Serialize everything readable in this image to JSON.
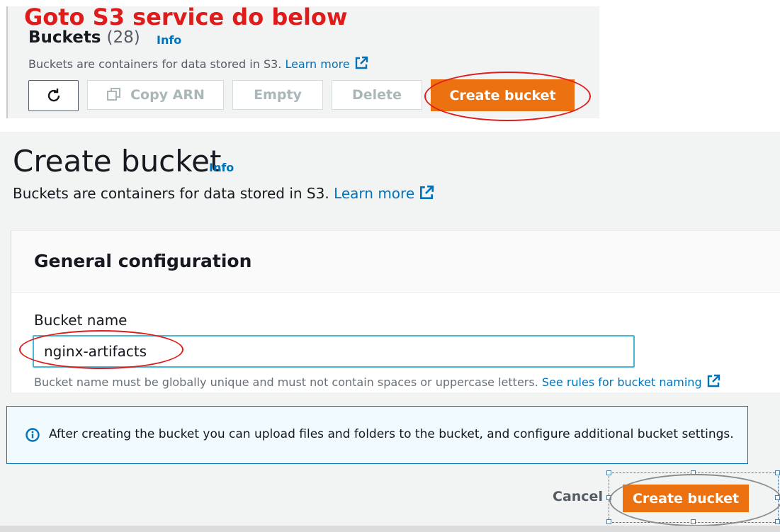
{
  "annotation": "Goto S3 service do below",
  "buckets_header": {
    "title": "Buckets",
    "count": "(28)",
    "info_link": "Info",
    "description": "Buckets are containers for data stored in S3.",
    "learn_more": "Learn more",
    "buttons": {
      "copy_arn": "Copy ARN",
      "empty": "Empty",
      "delete": "Delete",
      "create_bucket": "Create bucket"
    }
  },
  "create_page": {
    "title": "Create bucket",
    "info_link": "Info",
    "description": "Buckets are containers for data stored in S3.",
    "learn_more": "Learn more",
    "general_configuration": {
      "heading": "General configuration",
      "bucket_name_label": "Bucket name",
      "bucket_name_value": "nginx-artifacts",
      "hint": "Bucket name must be globally unique and must not contain spaces or uppercase letters.",
      "rules_link": "See rules for bucket naming"
    },
    "info_alert": "After creating the bucket you can upload files and folders to the bucket, and configure additional bucket settings.",
    "footer": {
      "cancel": "Cancel",
      "create_bucket": "Create bucket"
    }
  },
  "colors": {
    "primary_orange": "#ec7211",
    "link_blue": "#0073bb",
    "annotation_red": "#e01b1b",
    "input_focus": "#44b9d6"
  }
}
